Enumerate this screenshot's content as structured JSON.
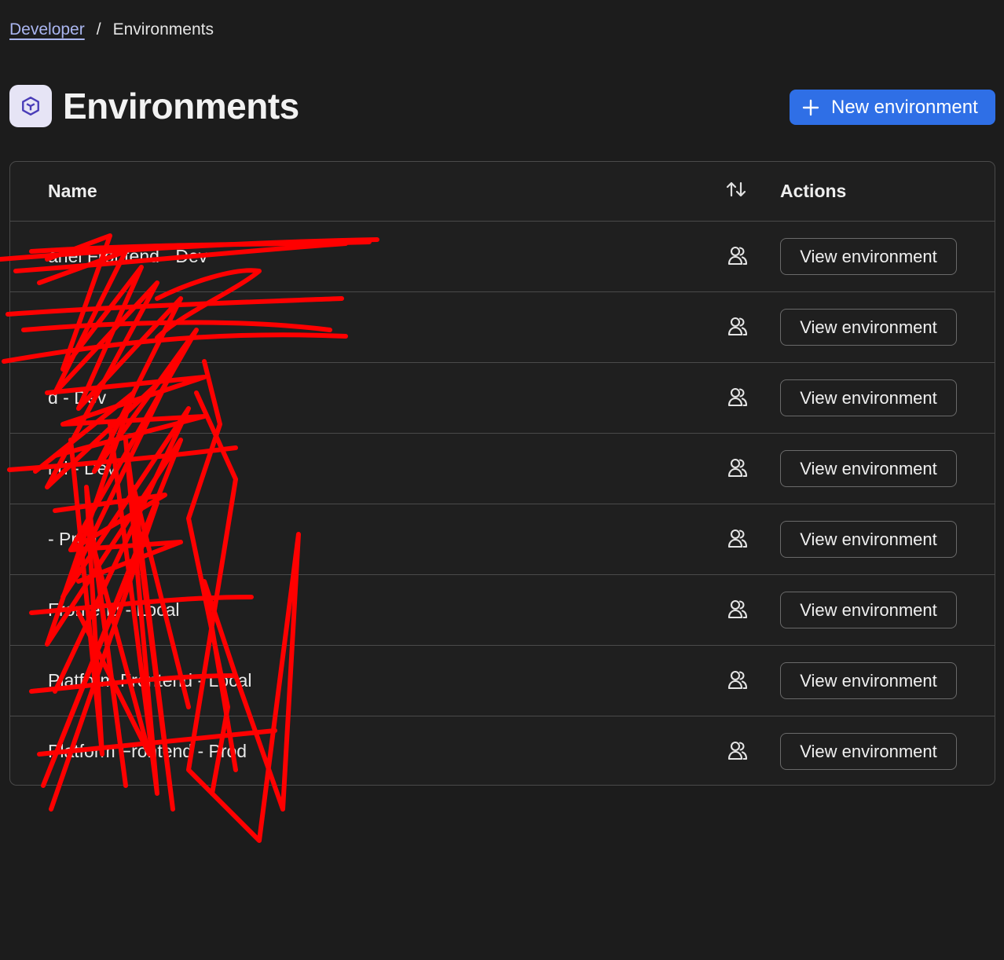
{
  "breadcrumb": {
    "parent": "Developer",
    "separator": "/",
    "current": "Environments"
  },
  "header": {
    "title": "Environments",
    "icon": "cube-icon",
    "new_button_label": "New environment",
    "new_button_icon": "plus-icon"
  },
  "colors": {
    "background": "#1c1c1c",
    "accent": "#2f6fe6",
    "border": "#4a4a4a",
    "link": "#aab6f0",
    "redaction": "#ff0000"
  },
  "table": {
    "columns": {
      "name": "Name",
      "sort_icon": "sort-arrows-icon",
      "actions": "Actions"
    },
    "rows": [
      {
        "name": "anel Frontend - Dev",
        "action": "View environment",
        "icon": "users-icon"
      },
      {
        "name": "",
        "action": "View environment",
        "icon": "users-icon"
      },
      {
        "name": "d - Dev",
        "action": "View environment",
        "icon": "users-icon"
      },
      {
        "name": "nd - Dev",
        "action": "View environment",
        "icon": "users-icon"
      },
      {
        "name": "- Prod",
        "action": "View environment",
        "icon": "users-icon"
      },
      {
        "name": "Frontend - Local",
        "action": "View environment",
        "icon": "users-icon"
      },
      {
        "name": "Platform Frontend - Local",
        "action": "View environment",
        "icon": "users-icon"
      },
      {
        "name": "Platform Frontend - Prod",
        "action": "View environment",
        "icon": "users-icon"
      }
    ]
  }
}
